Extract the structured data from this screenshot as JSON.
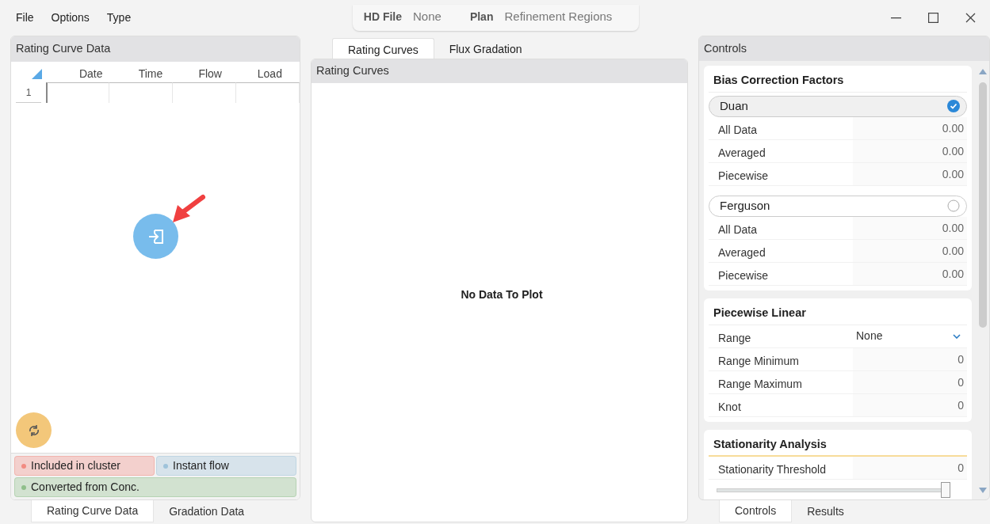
{
  "menu": [
    "File",
    "Options",
    "Type"
  ],
  "header_info": [
    {
      "label": "HD File",
      "value": "None"
    },
    {
      "label": "Plan",
      "value": "Refinement Regions"
    }
  ],
  "left_panel": {
    "title": "Rating Curve Data",
    "table": {
      "columns": [
        "Date",
        "Time",
        "Flow",
        "Load"
      ],
      "rows": [
        {
          "number": "1",
          "selected": true
        }
      ]
    },
    "legend": [
      {
        "text": "Included in cluster",
        "color": "#f28b82",
        "wide": false
      },
      {
        "text": "Instant flow",
        "color": "#9fc3da",
        "wide": false
      },
      {
        "text": "Converted from Conc.",
        "color": "#8fbf8a",
        "wide": true
      }
    ],
    "tabs": [
      {
        "label": "Rating Curve Data",
        "selected": true
      },
      {
        "label": "Gradation Data",
        "selected": false
      }
    ]
  },
  "middle_panel": {
    "tabs": [
      {
        "label": "Rating Curves",
        "selected": true
      },
      {
        "label": "Flux Gradation",
        "selected": false
      }
    ],
    "title": "Rating Curves",
    "message": "No Data To Plot"
  },
  "right_panel": {
    "title": "Controls",
    "sections": [
      {
        "title": "Bias Correction Factors",
        "kind": "methods",
        "methods": [
          {
            "name": "Duan",
            "selected": true,
            "rows": [
              {
                "label": "All Data",
                "value": "0.00"
              },
              {
                "label": "Averaged",
                "value": "0.00"
              },
              {
                "label": "Piecewise",
                "value": "0.00"
              }
            ]
          },
          {
            "name": "Ferguson",
            "selected": false,
            "rows": [
              {
                "label": "All Data",
                "value": "0.00"
              },
              {
                "label": "Averaged",
                "value": "0.00"
              },
              {
                "label": "Piecewise",
                "value": "0.00"
              }
            ]
          }
        ]
      },
      {
        "title": "Piecewise Linear",
        "kind": "rows",
        "rows": [
          {
            "label": "Range",
            "value": "None",
            "kind": "dropdown"
          },
          {
            "label": "Range Minimum",
            "value": "0",
            "kind": "value"
          },
          {
            "label": "Range Maximum",
            "value": "0",
            "kind": "value"
          },
          {
            "label": "Knot",
            "value": "0",
            "kind": "value"
          }
        ]
      },
      {
        "title": "Stationarity Analysis",
        "kind": "rows",
        "rows": [
          {
            "label": "Stationarity Threshold",
            "value": "0",
            "kind": "value"
          }
        ],
        "slider": {
          "level": 1
        }
      }
    ],
    "tabs": [
      {
        "label": "Controls",
        "selected": true
      },
      {
        "label": "Results",
        "selected": false
      }
    ]
  }
}
